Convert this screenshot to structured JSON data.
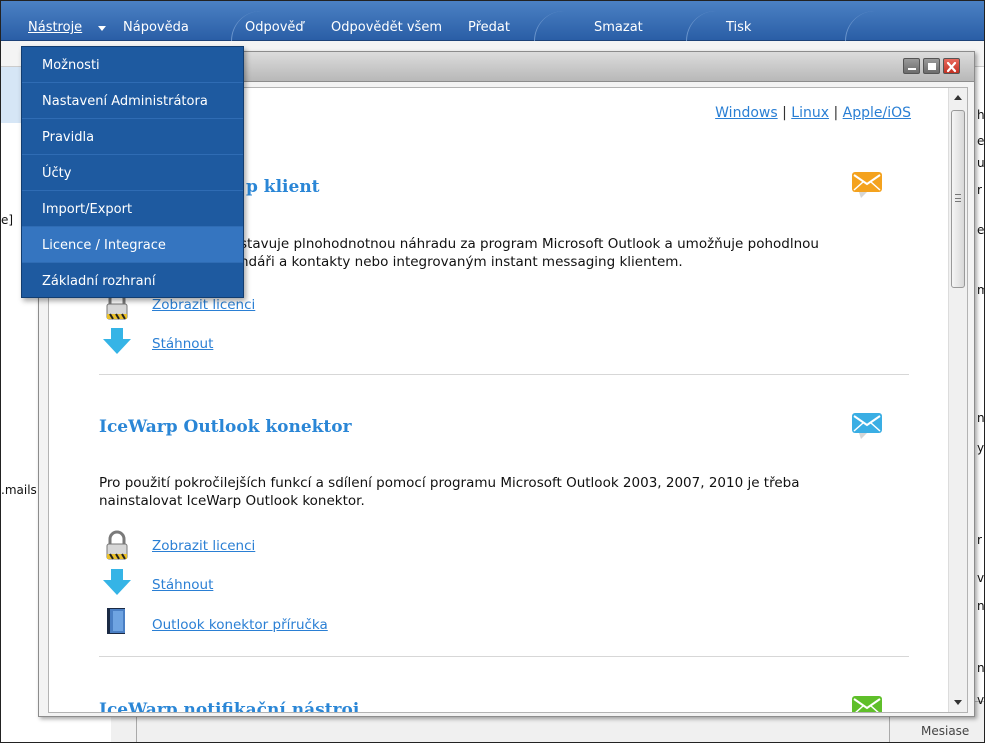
{
  "toolbar": {
    "tools": "Nástroje",
    "help": "Nápověda",
    "reply": "Odpověď",
    "reply_all": "Odpovědět všem",
    "forward": "Předat",
    "delete": "Smazat",
    "print": "Tisk"
  },
  "tools_menu": {
    "items": [
      {
        "label": "Možnosti"
      },
      {
        "label": "Nastavení Administrátora"
      },
      {
        "label": "Pravidla"
      },
      {
        "label": "Účty"
      },
      {
        "label": "Import/Export"
      },
      {
        "label": "Licence / Integrace",
        "highlighted": true
      },
      {
        "label": "Základní rozhraní"
      }
    ]
  },
  "platform_links": {
    "windows": "Windows",
    "sep": "|",
    "linux": "Linux",
    "apple": "Apple/iOS"
  },
  "sections": [
    {
      "title_partial": "p klient",
      "desc_line1": "stavuje plnohodnotnou náhradu za program Microsoft Outlook a umožňuje pohodlnou",
      "desc_line2": "ndáři a kontakty nebo integrovaným instant messaging klientem.",
      "links": [
        "Zobrazit licenci",
        "Stáhnout"
      ],
      "icon": "orange-mail-chat-icon"
    },
    {
      "title": "IceWarp Outlook konektor",
      "desc_line1": "Pro použití pokročilejších funkcí a sdílení pomocí programu Microsoft Outlook 2003, 2007, 2010 je třeba",
      "desc_line2": "nainstalovat IceWarp Outlook konektor.",
      "links": [
        "Zobrazit licenci",
        "Stáhnout",
        "Outlook konektor příručka"
      ],
      "icon": "blue-mail-chat-icon"
    },
    {
      "title": "IceWarp notifikační nástroj",
      "icon": "green-mail-chat-icon"
    }
  ],
  "background": {
    "left_fragment_1": "e]",
    "left_fragment_2": ".mails",
    "right_fragments": [
      "hý",
      "er",
      "us",
      "r",
      "er",
      "mo",
      "ne",
      "y",
      "r",
      "va",
      "na",
      "nic",
      "v",
      "le"
    ],
    "bottom_right": "Mesiase"
  },
  "colors": {
    "toolbar": "#3a71b8",
    "menu": "#1e5aa0",
    "menu_highlight": "#3575c0",
    "link": "#2a7fd4",
    "section_title": "#2a86d6"
  }
}
